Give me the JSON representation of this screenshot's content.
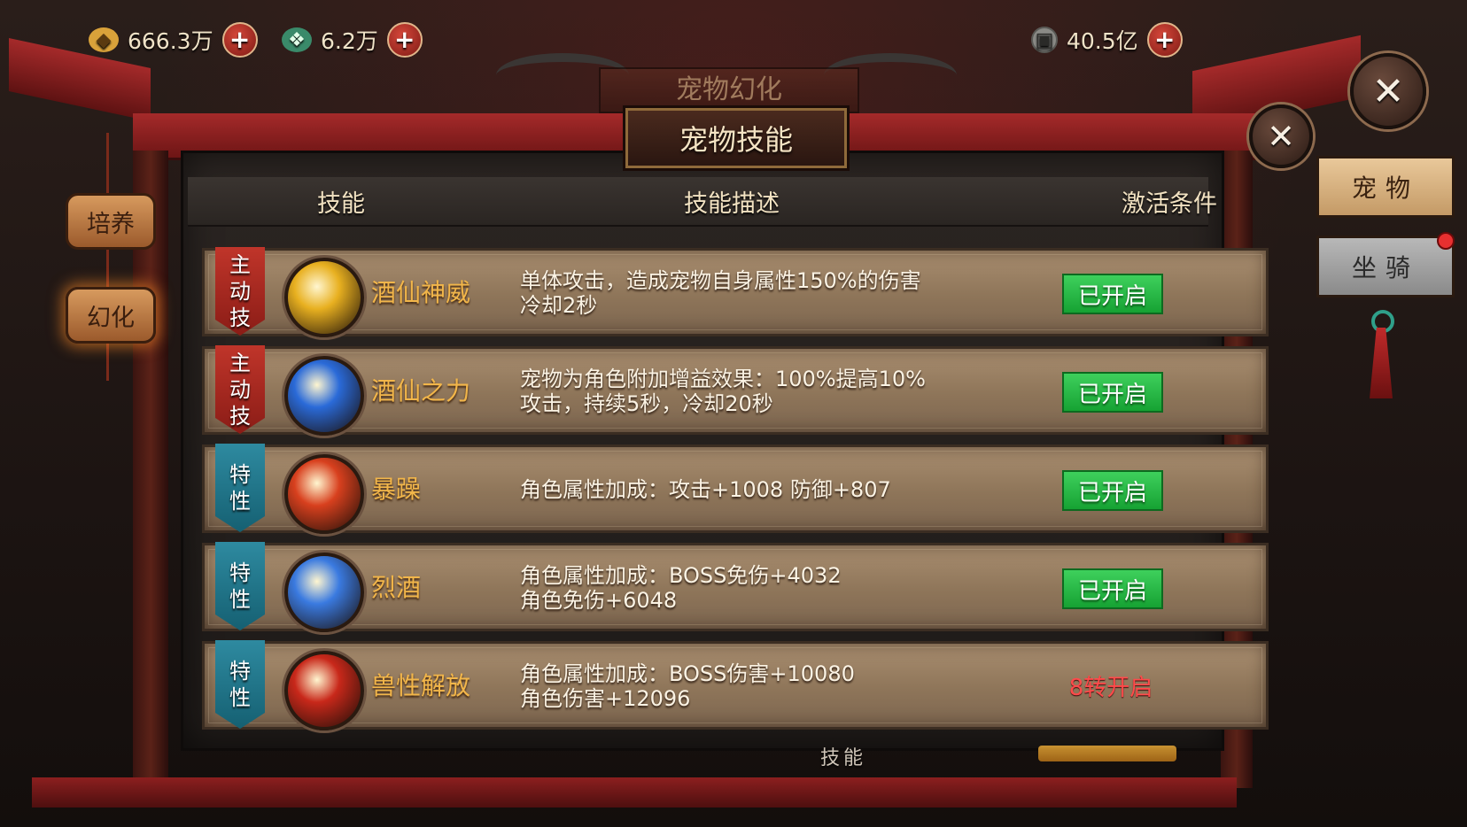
{
  "currencies": [
    {
      "icon": "gold-ingot-icon",
      "amount": "666.3万"
    },
    {
      "icon": "jade-pendant-icon",
      "amount": "6.2万"
    },
    {
      "icon": "coin-icon",
      "amount": "40.5亿"
    }
  ],
  "background_title": "宠物幻化",
  "dialog": {
    "title": "宠物技能",
    "close_glyph": "✕"
  },
  "columns": {
    "skill": "技能",
    "description": "技能描述",
    "condition": "激活条件"
  },
  "skills": [
    {
      "type": "active",
      "tag": [
        "主",
        "动",
        "技"
      ],
      "name": "酒仙神威",
      "desc": [
        "单体攻击，造成宠物自身属性150%的伤害",
        "冷却2秒"
      ],
      "status": "已开启",
      "unlocked": true,
      "icon_color": "#e8b020"
    },
    {
      "type": "active",
      "tag": [
        "主",
        "动",
        "技"
      ],
      "name": "酒仙之力",
      "desc": [
        "宠物为角色附加增益效果：100%提高10%",
        "攻击，持续5秒，冷却20秒"
      ],
      "status": "已开启",
      "unlocked": true,
      "icon_color": "#2a6ad8"
    },
    {
      "type": "trait",
      "tag": [
        "特",
        "性"
      ],
      "name": "暴躁",
      "desc": [
        "角色属性加成：攻击+1008 防御+807"
      ],
      "status": "已开启",
      "unlocked": true,
      "icon_color": "#d8401e"
    },
    {
      "type": "trait",
      "tag": [
        "特",
        "性"
      ],
      "name": "烈酒",
      "desc": [
        "角色属性加成：BOSS免伤+4032",
        "角色免伤+6048"
      ],
      "status": "已开启",
      "unlocked": true,
      "icon_color": "#3a7ae0"
    },
    {
      "type": "trait",
      "tag": [
        "特",
        "性"
      ],
      "name": "兽性解放",
      "desc": [
        "角色属性加成：BOSS伤害+10080",
        "角色伤害+12096"
      ],
      "status": "8转开启",
      "unlocked": false,
      "icon_color": "#c8281a"
    }
  ],
  "left_tabs": {
    "train": "培养",
    "transform": "幻化"
  },
  "right_tabs": {
    "pet": "宠物",
    "mount": "坐骑"
  },
  "bottom_label": "技能"
}
